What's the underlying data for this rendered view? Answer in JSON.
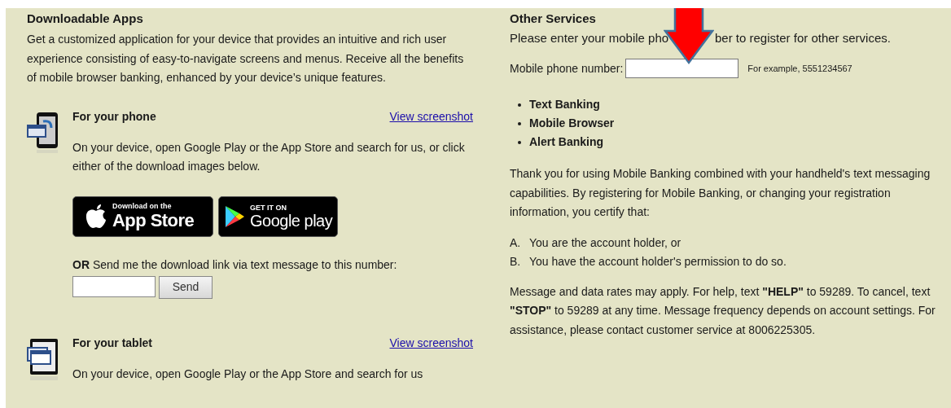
{
  "left": {
    "heading": "Downloadable Apps",
    "intro": "Get a customized application for your device that provides an intuitive and rich user experience consisting of easy-to-navigate screens and menus. Receive all the benefits of mobile browser banking, enhanced by your device’s unique features.",
    "apps": [
      {
        "kind": "phone",
        "title": "For your phone",
        "link": "View screenshot",
        "description": "On your device, open Google Play or the App Store and search for us, or click either of the download images below.",
        "badges": [
          {
            "kind": "apple",
            "small": "Download on the",
            "big": "App Store"
          },
          {
            "kind": "google",
            "small": "GET IT ON",
            "big": "Google play"
          }
        ],
        "send_text": "**OR** Send me the download link via text message to this number:",
        "send_button": "Send"
      },
      {
        "kind": "tablet",
        "title": "For your tablet",
        "link": "View screenshot",
        "description": "On your device, open Google Play or the App Store and search for us"
      }
    ]
  },
  "right": {
    "heading": "Other Services",
    "intro_parts": [
      "Please enter your mobile pho",
      "ber to register for other services."
    ],
    "field_label": "Mobile phone number:",
    "field_hint": "For example, 5551234567",
    "services": [
      "Text Banking",
      "Mobile Browser",
      "Alert Banking"
    ],
    "paragraph": "Thank you for using Mobile Banking combined with your handheld's text messaging capabilities. By registering for Mobile Banking, or changing your registration information, you certify that:",
    "conditions": [
      {
        "marker": "A.",
        "text": "You are the account holder, or"
      },
      {
        "marker": "B.",
        "text": "You have the account holder's permission to do so."
      }
    ],
    "footer": "Message and data rates may apply. For help, text **\"HELP\"** to 59289. To cancel, text **\"STOP\"** to 59289 at any time. Message frequency depends on account settings. For assistance, please contact customer service at 8006225305."
  }
}
